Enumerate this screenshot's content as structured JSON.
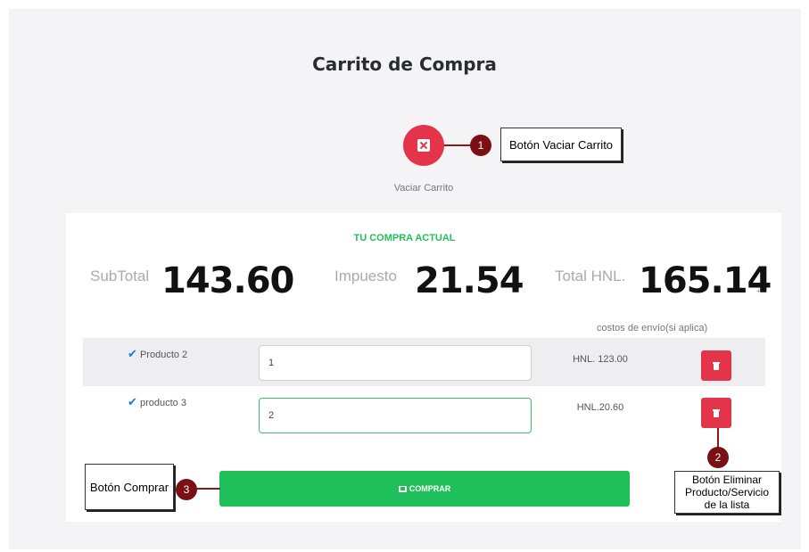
{
  "page": {
    "title": "Carrito de Compra"
  },
  "empty_cart": {
    "label": "Vaciar Carrito",
    "icon": "close-box-icon"
  },
  "summary": {
    "section_title": "TU COMPRA ACTUAL",
    "subtotal_label": "SubTotal",
    "subtotal_value": "143.60",
    "tax_label": "Impuesto",
    "tax_value": "21.54",
    "total_label": "Total HNL.",
    "total_value": "165.14",
    "total_suffix": "+",
    "shipping_note": "costos de envío(si aplica)"
  },
  "items": [
    {
      "check": "✔",
      "name": "Producto 2",
      "quantity": "1",
      "price": "HNL. 123.00"
    },
    {
      "check": "✔",
      "name": "producto 3",
      "quantity": "2",
      "price": "HNL.20.60"
    }
  ],
  "buy_button": {
    "label": "COMPRAR",
    "icon": "cart-icon"
  },
  "annotations": {
    "one": {
      "number": "1",
      "text": "Botón Vaciar Carrito"
    },
    "two": {
      "number": "2",
      "text": "Botón Eliminar Producto/Servicio de la lista"
    },
    "three": {
      "number": "3",
      "text": "Botón Comprar"
    }
  },
  "colors": {
    "accent_green": "#1fbf5a",
    "danger_red": "#e3344a",
    "badge_red": "#7a0f14",
    "check_blue": "#1a7ad9"
  }
}
